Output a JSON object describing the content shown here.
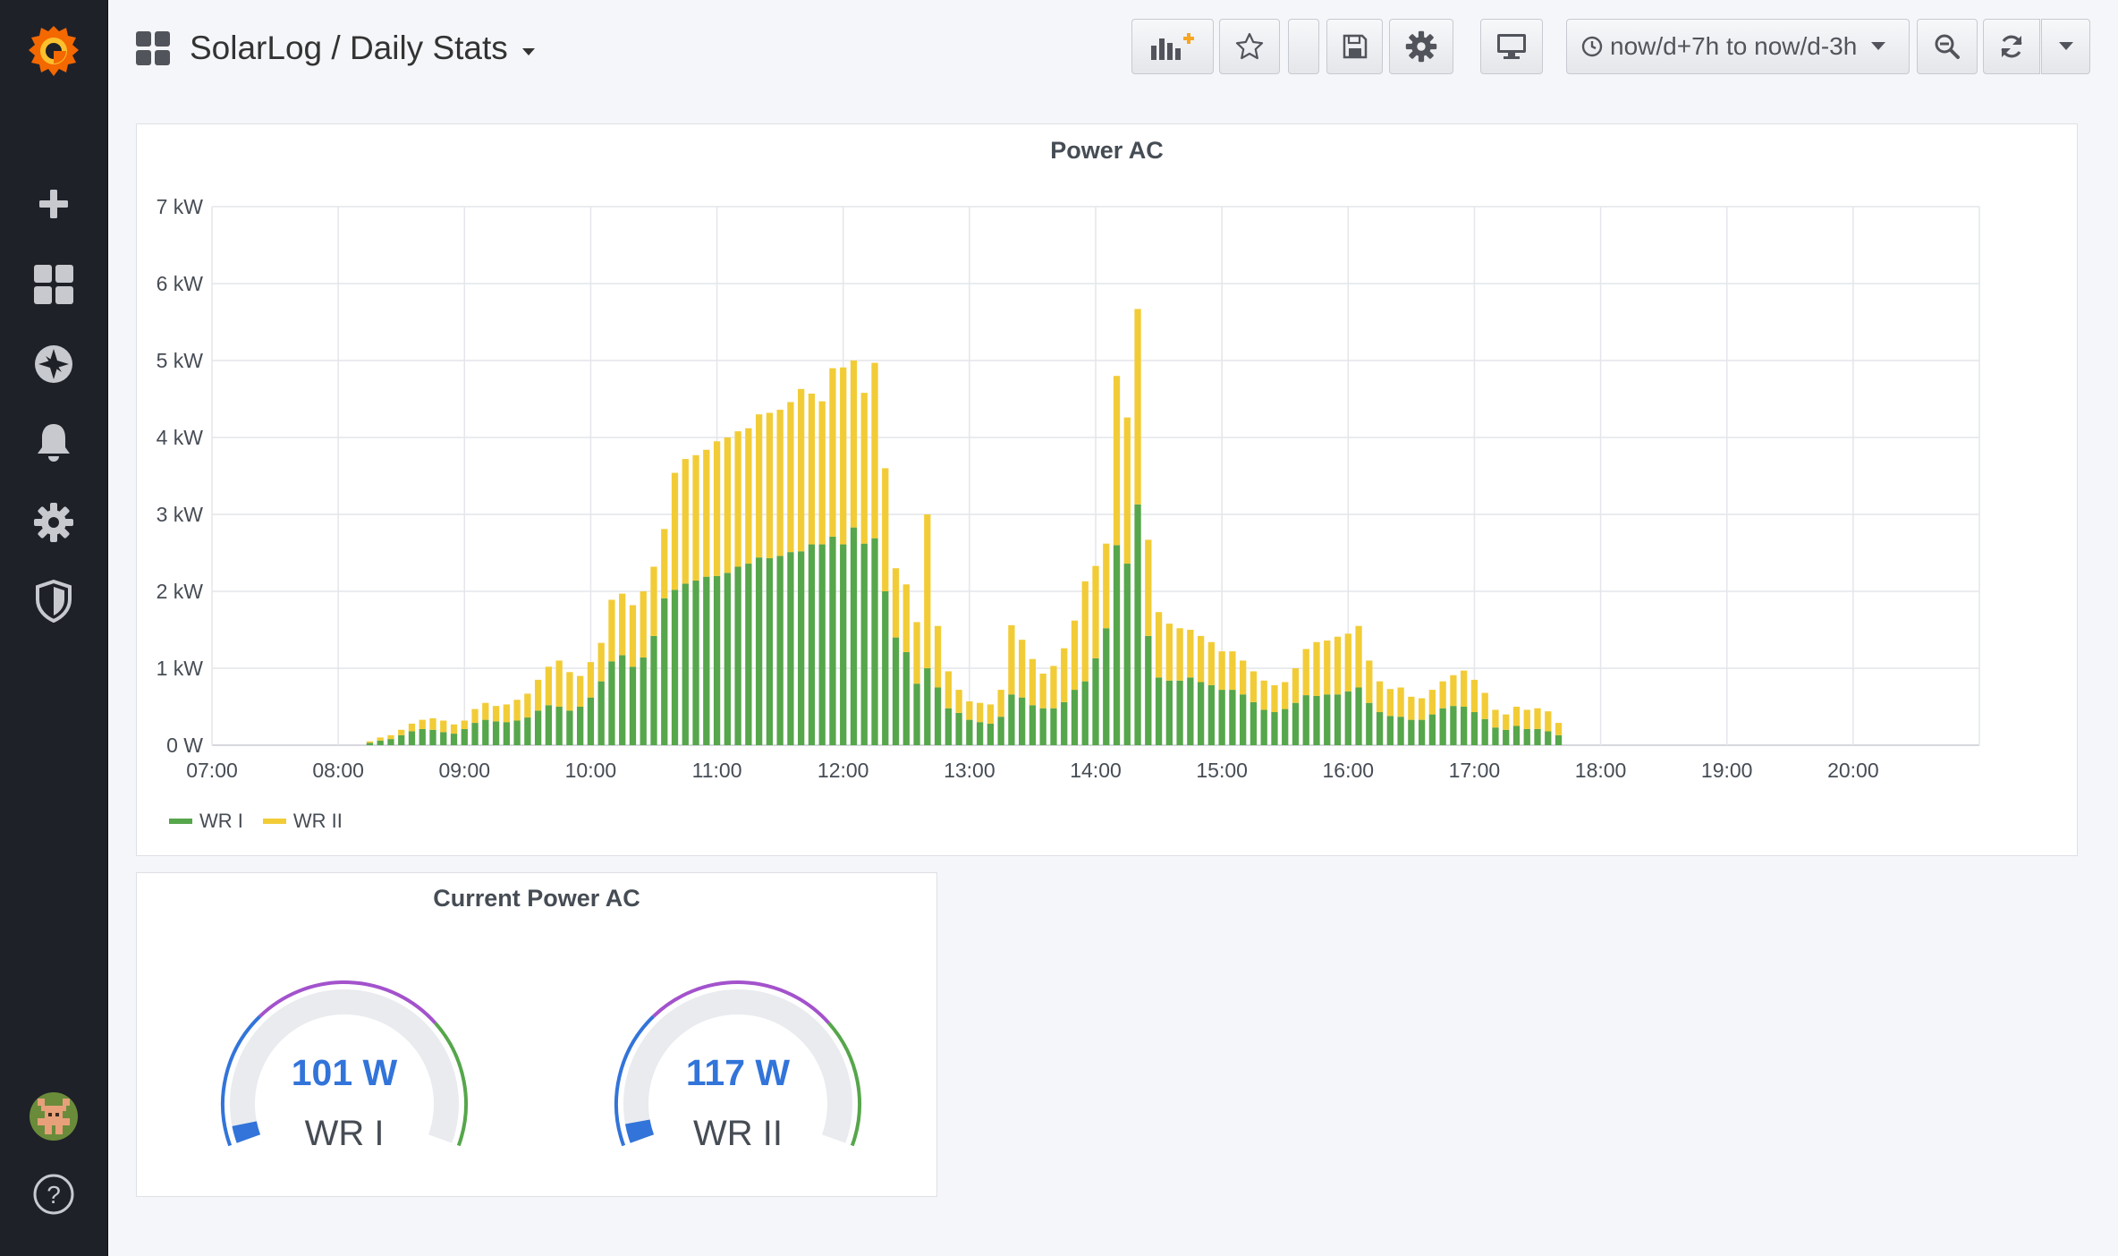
{
  "sidebar": {
    "logo_icon": "grafana-logo-icon",
    "items": [
      {
        "icon": "plus-icon",
        "name": "create"
      },
      {
        "icon": "dashboards-icon",
        "name": "dashboards"
      },
      {
        "icon": "compass-icon",
        "name": "explore"
      },
      {
        "icon": "bell-icon",
        "name": "alerting"
      },
      {
        "icon": "gear-icon",
        "name": "configuration"
      },
      {
        "icon": "shield-icon",
        "name": "server-admin"
      }
    ],
    "avatar_icon": "user-avatar-icon",
    "help_label": "?"
  },
  "header": {
    "title": "SolarLog / Daily Stats",
    "time_range": "now/d+7h to now/d-3h"
  },
  "colors": {
    "wr1": "#56a64b",
    "wr2": "#f2cc37",
    "gauge_blue": "#3274d9",
    "gauge_green": "#56a64b",
    "gauge_purple": "#a352cc"
  },
  "panels": {
    "power_ac": {
      "title": "Power AC"
    },
    "current_power": {
      "title": "Current Power AC",
      "gauges": [
        {
          "value": "101 W",
          "label": "WR I",
          "fraction": 0.04
        },
        {
          "value": "117 W",
          "label": "WR II",
          "fraction": 0.045
        }
      ]
    }
  },
  "chart_data": {
    "type": "bar",
    "stacked": true,
    "title": "Power AC",
    "x_tick_labels": [
      "07:00",
      "08:00",
      "09:00",
      "10:00",
      "11:00",
      "12:00",
      "13:00",
      "14:00",
      "15:00",
      "16:00",
      "17:00",
      "18:00",
      "19:00",
      "20:00"
    ],
    "y_tick_labels": [
      "0 W",
      "1 kW",
      "2 kW",
      "3 kW",
      "4 kW",
      "5 kW",
      "6 kW",
      "7 kW"
    ],
    "xlim": [
      "07:00",
      "21:00"
    ],
    "ylim": [
      0,
      7000
    ],
    "grid": true,
    "legend_position": "bottom-left",
    "x": [
      "08:15",
      "08:20",
      "08:25",
      "08:30",
      "08:35",
      "08:40",
      "08:45",
      "08:50",
      "08:55",
      "09:00",
      "09:05",
      "09:10",
      "09:15",
      "09:20",
      "09:25",
      "09:30",
      "09:35",
      "09:40",
      "09:45",
      "09:50",
      "09:55",
      "10:00",
      "10:05",
      "10:10",
      "10:15",
      "10:20",
      "10:25",
      "10:30",
      "10:35",
      "10:40",
      "10:45",
      "10:50",
      "10:55",
      "11:00",
      "11:05",
      "11:10",
      "11:15",
      "11:20",
      "11:25",
      "11:30",
      "11:35",
      "11:40",
      "11:45",
      "11:50",
      "11:55",
      "12:00",
      "12:05",
      "12:10",
      "12:15",
      "12:20",
      "12:25",
      "12:30",
      "12:35",
      "12:40",
      "12:45",
      "12:50",
      "12:55",
      "13:00",
      "13:05",
      "13:10",
      "13:15",
      "13:20",
      "13:25",
      "13:30",
      "13:35",
      "13:40",
      "13:45",
      "13:50",
      "13:55",
      "14:00",
      "14:05",
      "14:10",
      "14:15",
      "14:20",
      "14:25",
      "14:30",
      "14:35",
      "14:40",
      "14:45",
      "14:50",
      "14:55",
      "15:00",
      "15:05",
      "15:10",
      "15:15",
      "15:20",
      "15:25",
      "15:30",
      "15:35",
      "15:40",
      "15:45",
      "15:50",
      "15:55",
      "16:00",
      "16:05",
      "16:10",
      "16:15",
      "16:20",
      "16:25",
      "16:30",
      "16:35",
      "16:40",
      "16:45",
      "16:50",
      "16:55",
      "17:00",
      "17:05",
      "17:10",
      "17:15",
      "17:20",
      "17:25",
      "17:30",
      "17:35",
      "17:40"
    ],
    "series": [
      {
        "name": "WR I",
        "values": [
          30,
          60,
          80,
          130,
          180,
          210,
          200,
          170,
          150,
          210,
          290,
          330,
          310,
          300,
          320,
          360,
          450,
          520,
          500,
          450,
          500,
          620,
          830,
          1090,
          1170,
          1020,
          1140,
          1420,
          1910,
          2020,
          2100,
          2140,
          2190,
          2200,
          2240,
          2320,
          2360,
          2440,
          2430,
          2460,
          2510,
          2520,
          2610,
          2610,
          2710,
          2610,
          2830,
          2620,
          2690,
          2000,
          1400,
          1210,
          800,
          1000,
          750,
          480,
          420,
          330,
          300,
          280,
          370,
          660,
          620,
          520,
          480,
          480,
          560,
          720,
          830,
          1130,
          1520,
          2600,
          2360,
          3130,
          1420,
          880,
          840,
          840,
          880,
          820,
          780,
          720,
          720,
          660,
          560,
          460,
          430,
          470,
          550,
          650,
          640,
          660,
          660,
          700,
          750,
          550,
          430,
          380,
          370,
          330,
          330,
          400,
          480,
          510,
          500,
          430,
          340,
          230,
          200,
          250,
          210,
          210,
          180,
          130,
          90,
          70,
          60,
          50
        ],
        "values_note": ""
      },
      {
        "name": "WR II",
        "values": [
          20,
          40,
          50,
          70,
          100,
          120,
          150,
          150,
          120,
          110,
          180,
          220,
          200,
          230,
          270,
          310,
          400,
          500,
          600,
          500,
          400,
          460,
          500,
          800,
          800,
          800,
          860,
          900,
          900,
          1520,
          1620,
          1630,
          1650,
          1750,
          1760,
          1760,
          1760,
          1860,
          1890,
          1900,
          1950,
          2110,
          1960,
          1860,
          2190,
          2300,
          2170,
          1960,
          2280,
          1600,
          900,
          880,
          800,
          2000,
          800,
          480,
          300,
          240,
          250,
          250,
          350,
          900,
          750,
          600,
          450,
          550,
          700,
          900,
          1300,
          1200,
          1100,
          2200,
          1900,
          2540,
          1250,
          850,
          740,
          680,
          620,
          600,
          560,
          500,
          500,
          440,
          400,
          380,
          350,
          350,
          450,
          600,
          700,
          700,
          750,
          750,
          800,
          550,
          400,
          350,
          380,
          300,
          280,
          320,
          350,
          400,
          470,
          420,
          340,
          230,
          200,
          250,
          250,
          270,
          260,
          160,
          120,
          80,
          60,
          40
        ]
      }
    ]
  }
}
